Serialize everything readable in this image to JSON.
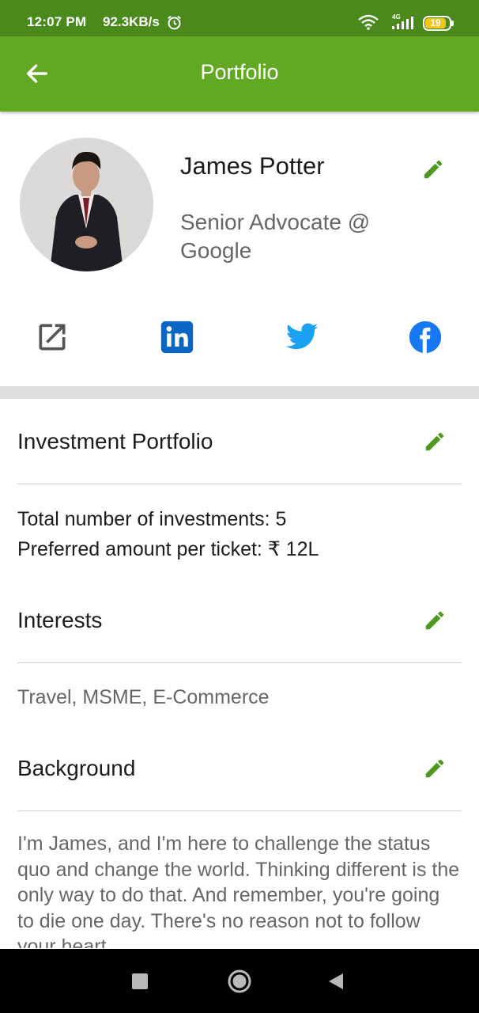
{
  "status_bar": {
    "time": "12:07 PM",
    "speed": "92.3KB/s",
    "battery": "19",
    "network": "4G"
  },
  "app_bar": {
    "title": "Portfolio",
    "back_icon": "arrow-left-icon"
  },
  "profile": {
    "name": "James Potter",
    "role": "Senior Advocate @ Google",
    "avatar": "profile-photo"
  },
  "social_links": [
    {
      "name": "external-link-icon",
      "color": "#555555"
    },
    {
      "name": "linkedin-icon",
      "color": "#0a66c2"
    },
    {
      "name": "twitter-icon",
      "color": "#1da1f2"
    },
    {
      "name": "facebook-icon",
      "color": "#1877f2"
    }
  ],
  "sections": {
    "investment": {
      "title": "Investment Portfolio",
      "line1": "Total number of investments: 5",
      "line2": "Preferred amount per ticket: ₹ 12L"
    },
    "interests": {
      "title": "Interests",
      "text": "Travel, MSME, E-Commerce"
    },
    "background": {
      "title": "Background",
      "text": "I'm James, and I'm here to challenge the status quo and change the world. Thinking different is the only way to do that. And remember, you're going to die one day. There's no reason not to follow your heart."
    }
  },
  "colors": {
    "status_bar": "#4a8a1c",
    "app_bar": "#63a822",
    "edit_icon": "#4e9a1e"
  },
  "nav_bar": {
    "recent": "square-icon",
    "home": "circle-icon",
    "back": "triangle-back-icon"
  }
}
